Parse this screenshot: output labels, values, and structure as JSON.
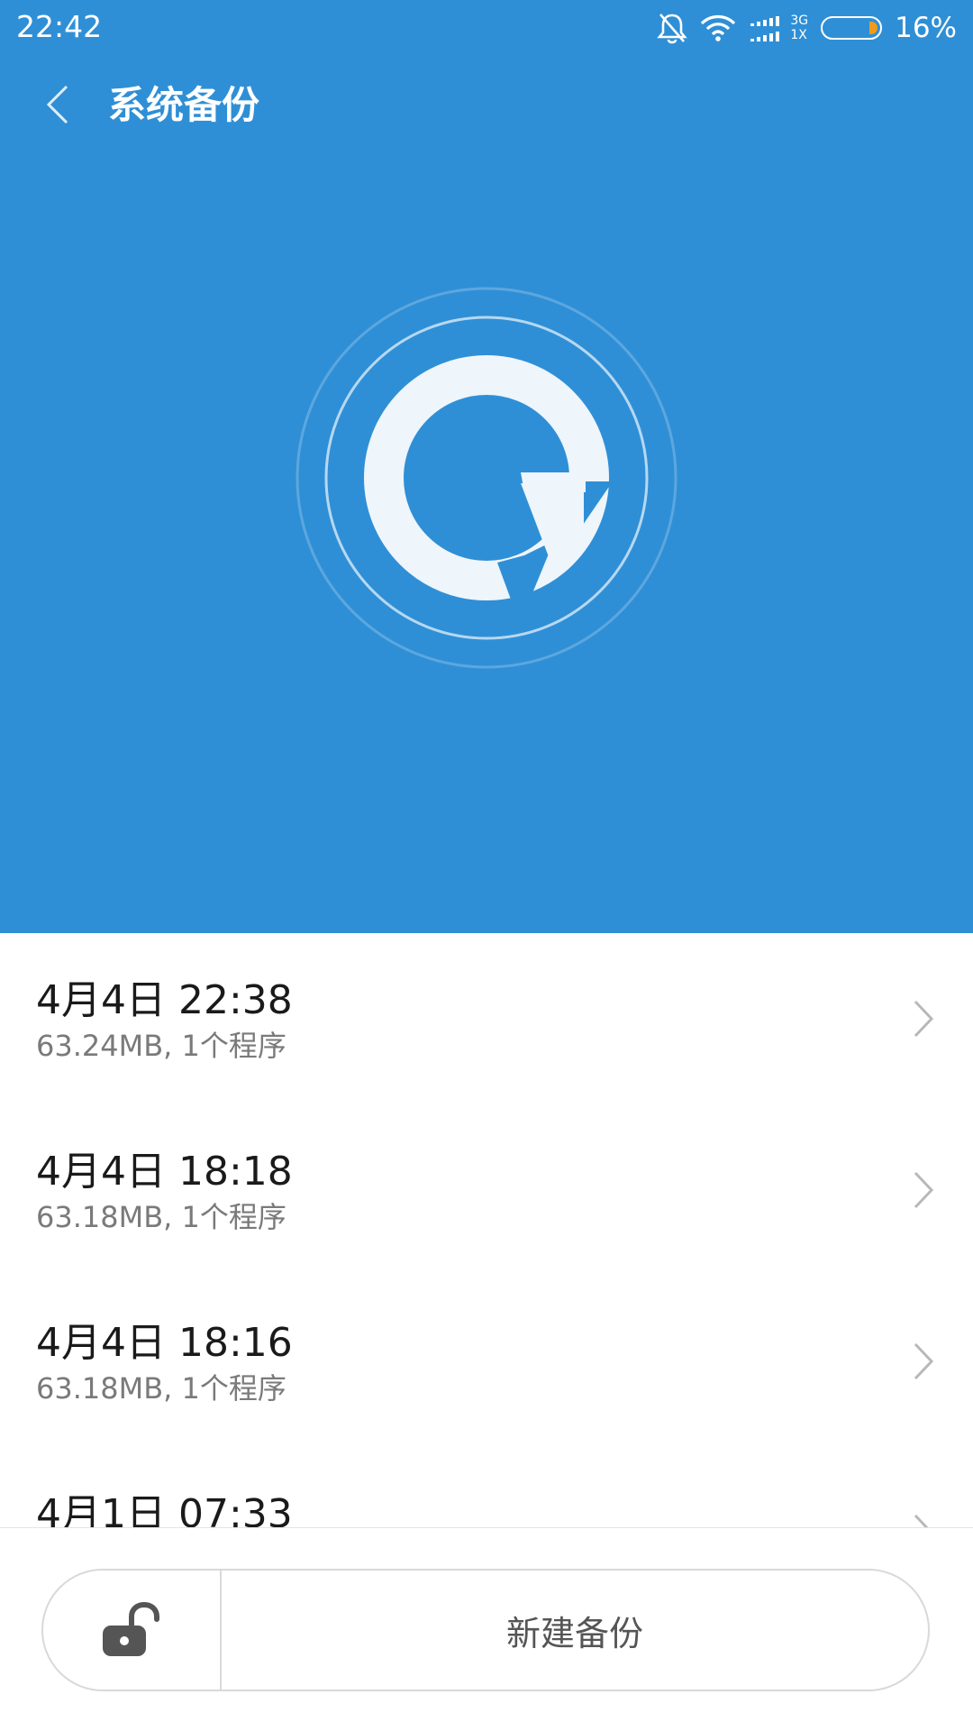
{
  "status_bar": {
    "time": "22:42",
    "icons": [
      "bell-off-icon",
      "wifi-icon",
      "signal-icon",
      "battery-icon"
    ],
    "network_top": "3G",
    "network_bottom": "1X",
    "battery_percent": "16%",
    "battery_level": 0.16
  },
  "header": {
    "title": "系统备份"
  },
  "colors": {
    "header_bg": "#2f8fd6",
    "battery_fill": "#f39a1a"
  },
  "backups": [
    {
      "title": "4月4日 22:38",
      "subtitle": "63.24MB, 1个程序"
    },
    {
      "title": "4月4日 18:18",
      "subtitle": "63.18MB, 1个程序"
    },
    {
      "title": "4月4日 18:16",
      "subtitle": "63.18MB, 1个程序"
    },
    {
      "title": "4月1日 07:33",
      "subtitle": ""
    }
  ],
  "bottom": {
    "lock_icon": "unlock-icon",
    "new_backup_label": "新建备份"
  }
}
